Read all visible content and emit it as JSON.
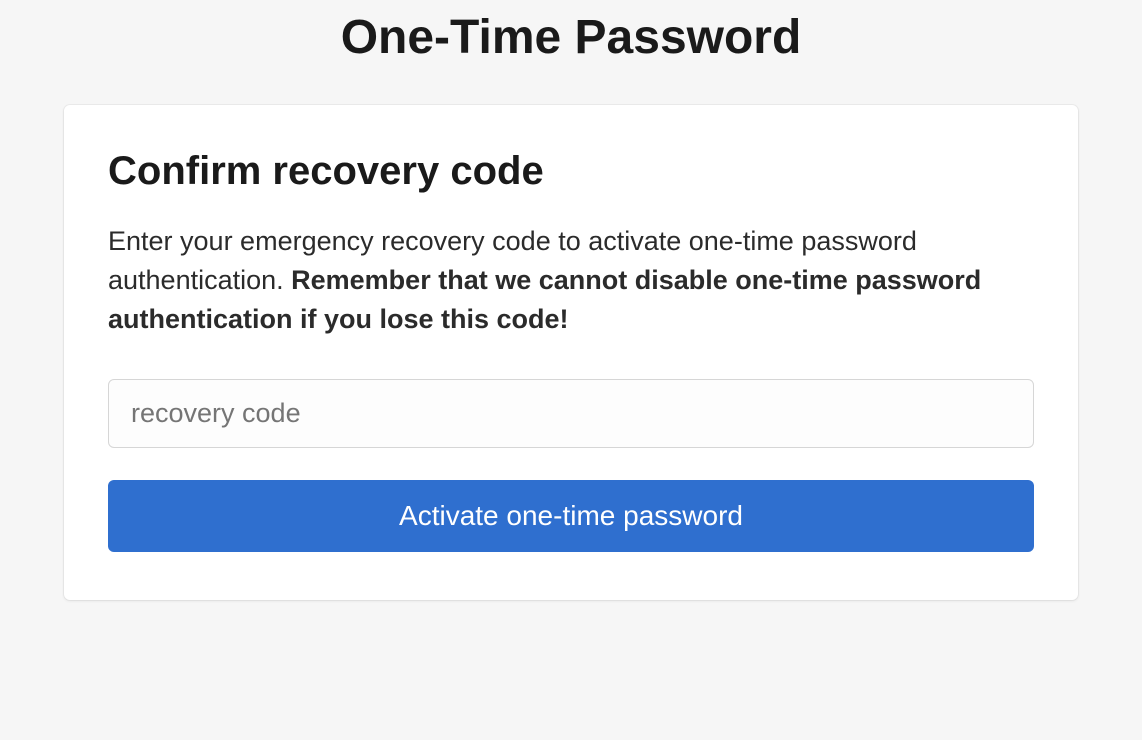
{
  "page": {
    "title": "One-Time Password"
  },
  "card": {
    "heading": "Confirm recovery code",
    "description_plain": "Enter your emergency recovery code to activate one-time password authentication. ",
    "description_bold": "Remember that we cannot disable one-time password authentication if you lose this code!",
    "input": {
      "placeholder": "recovery code",
      "value": ""
    },
    "button_label": "Activate one-time password"
  }
}
